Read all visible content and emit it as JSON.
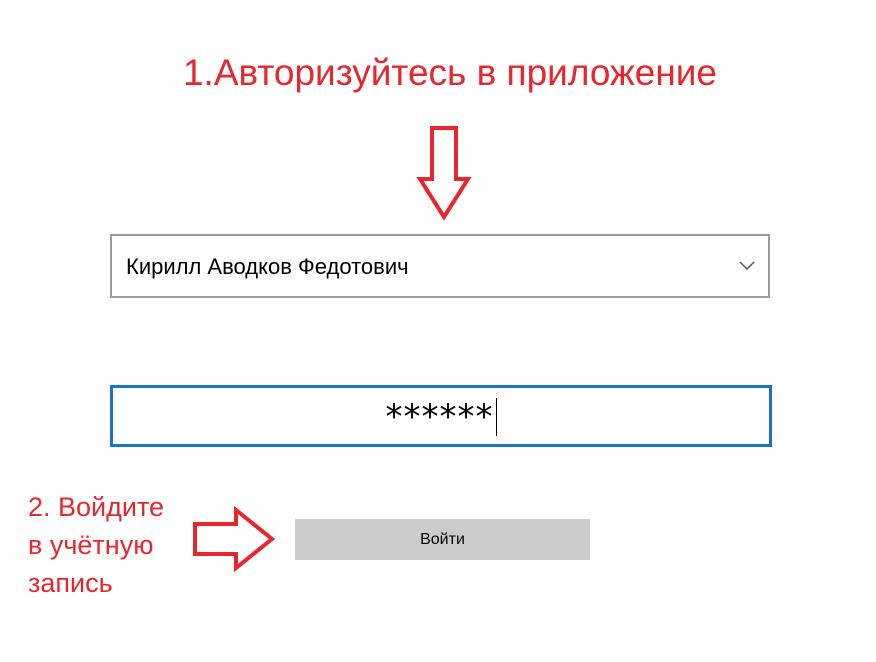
{
  "instructions": {
    "step1": "1.Авторизуйтесь в приложение",
    "step2_lines": [
      "2. Войдите",
      "в учётную",
      "запись"
    ]
  },
  "login_form": {
    "user_select_value": "Кирилл Аводков Федотович",
    "password_value": "******",
    "login_button_label": "Войти"
  },
  "colors": {
    "annotation": "#e8262e",
    "focus_border": "#1874c9",
    "button_bg": "#cccccc"
  },
  "icons": {
    "dropdown": "chevron-down-icon",
    "annotation_arrows": [
      "arrow-down-icon",
      "arrow-right-icon"
    ]
  }
}
